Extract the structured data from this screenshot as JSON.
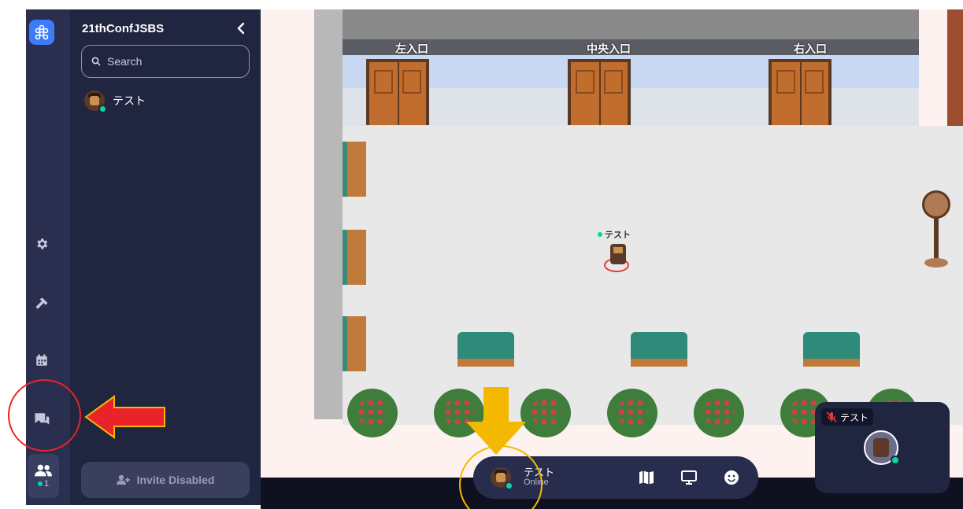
{
  "sidebar": {
    "space_name": "21thConfJSBS",
    "search_placeholder": "Search",
    "members": [
      {
        "name": "テスト",
        "status": "online"
      }
    ],
    "invite_label": "Invite Disabled",
    "online_count": "1"
  },
  "map": {
    "entrance_signs": [
      "左入口",
      "中央入口",
      "右入口"
    ],
    "player_label": "テスト"
  },
  "control_bar": {
    "name": "テスト",
    "status": "Online",
    "icons": [
      "map-icon",
      "screen-share-icon",
      "emoji-icon"
    ]
  },
  "video_tile": {
    "name": "テスト",
    "mic": "muted"
  },
  "colors": {
    "accent": "#3e7bfa",
    "online": "#06d6a0",
    "annotation_red": "#e8232a",
    "annotation_yellow": "#f5b800"
  }
}
